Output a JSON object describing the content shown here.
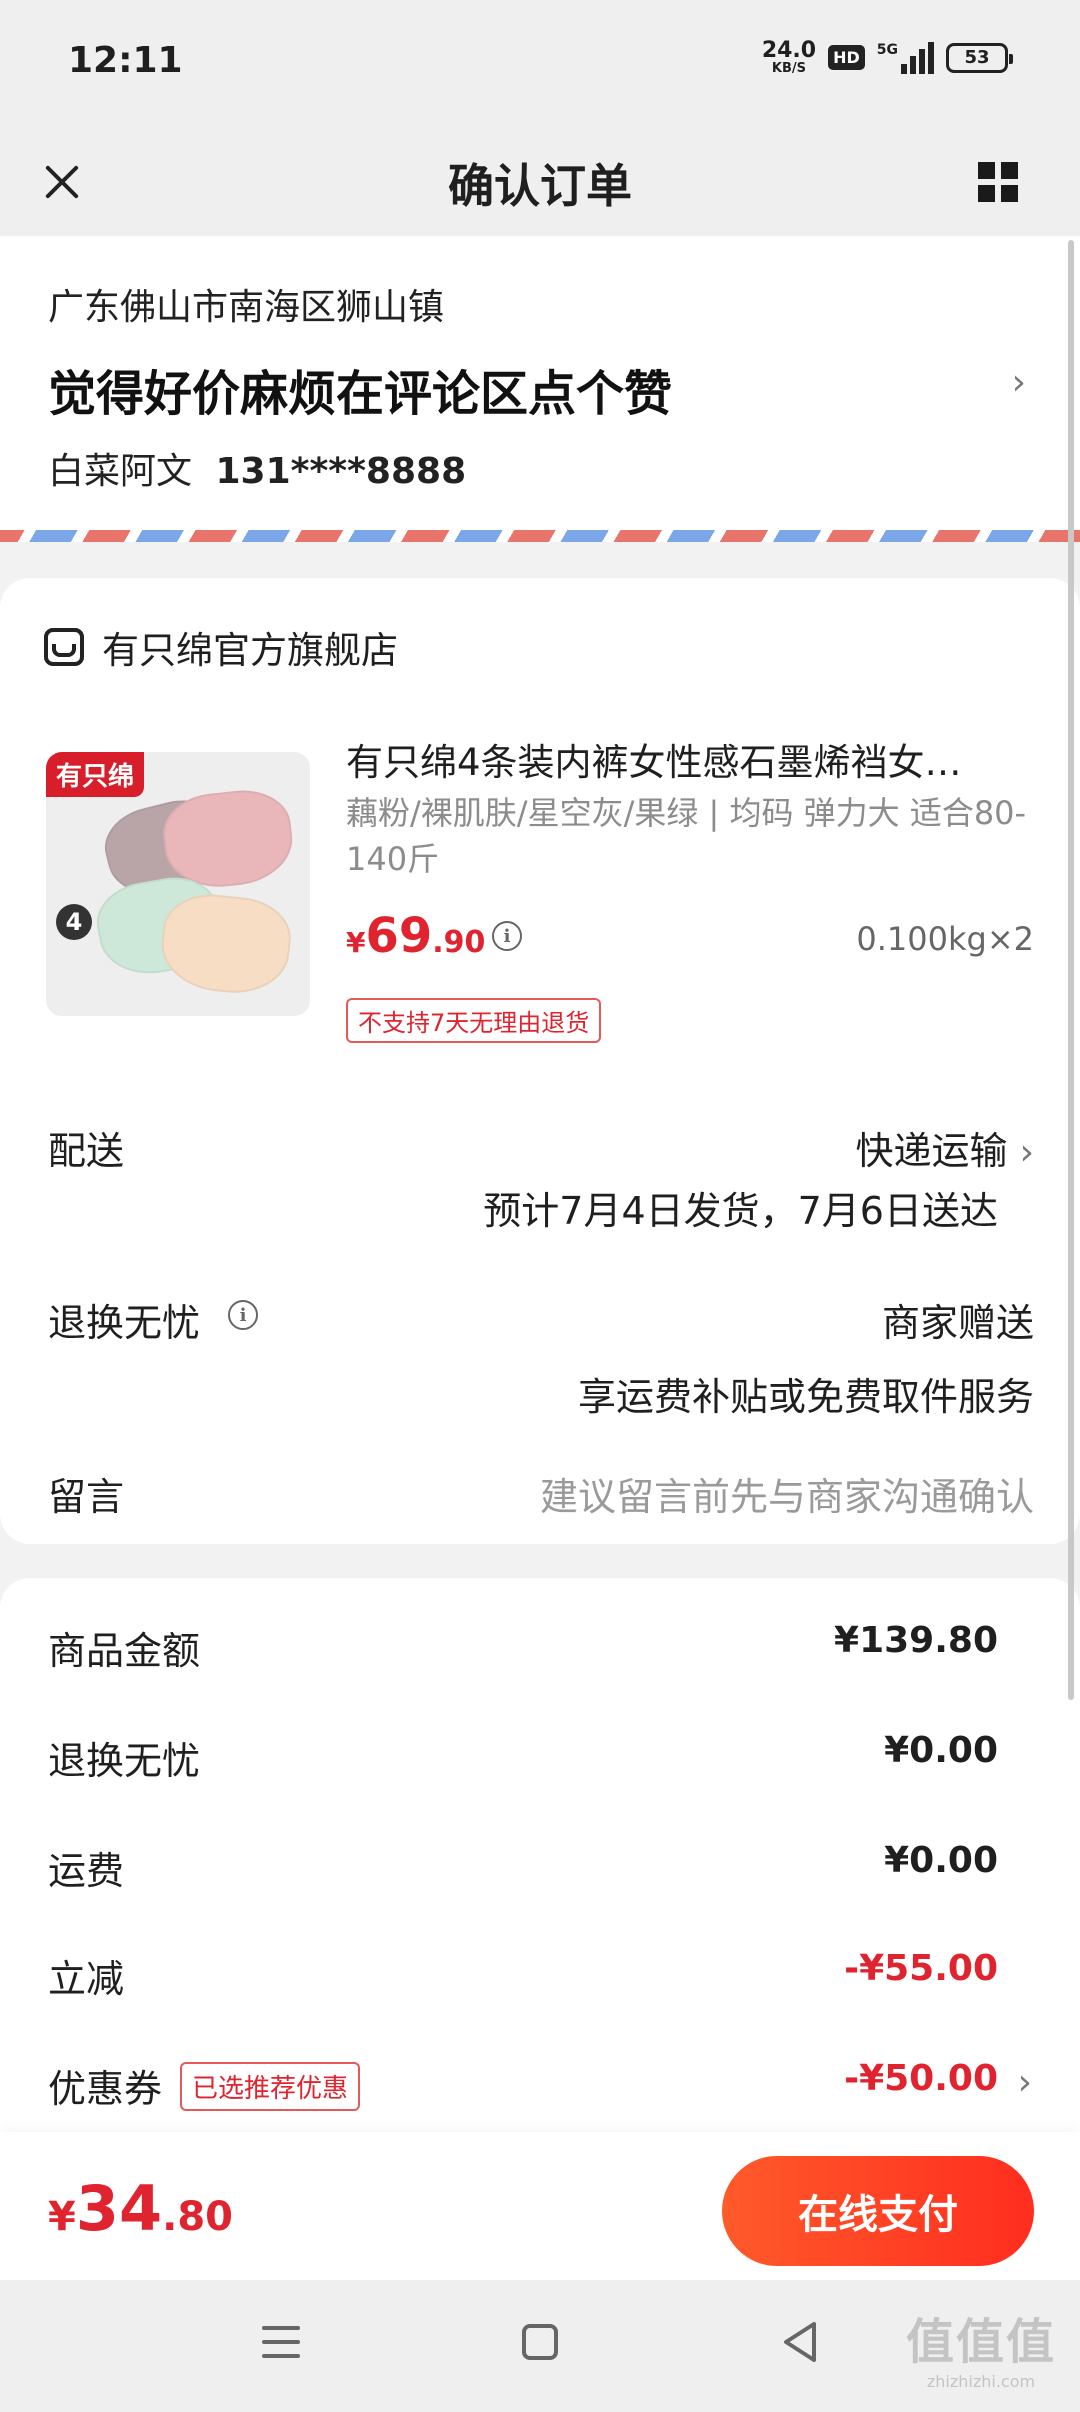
{
  "status_bar": {
    "time": "12:11",
    "net_speed": "24.0",
    "net_unit": "KB/S",
    "hd": "HD",
    "signal": "5G",
    "battery": "53"
  },
  "header": {
    "title": "确认订单"
  },
  "address": {
    "region": "广东佛山市南海区狮山镇",
    "detail": "觉得好价麻烦在评论区点个赞",
    "name": "白菜阿文",
    "phone": "131****8888"
  },
  "store": {
    "name": "有只绵官方旗舰店"
  },
  "product": {
    "thumb_brand": "有只绵",
    "thumb_count": "4",
    "title": "有只绵4条装内裤女性感石墨烯裆女…",
    "spec": "藕粉/裸肌肤/星空灰/果绿 | 均码 弹力大 适合80-140斤",
    "price_currency": "¥",
    "price_int": "69",
    "price_dec": ".90",
    "qty": "0.100kg×2",
    "tag": "不支持7天无理由退货"
  },
  "delivery": {
    "label": "配送",
    "method": "快递运输",
    "estimate": "预计7月4日发货，7月6日送达"
  },
  "exchange": {
    "label": "退换无忧",
    "value": "商家赠送",
    "desc": "享运费补贴或免费取件服务"
  },
  "message": {
    "label": "留言",
    "placeholder": "建议留言前先与商家沟通确认"
  },
  "amounts": {
    "goods_label": "商品金额",
    "goods_value": "¥139.80",
    "exchange_label": "退换无忧",
    "exchange_value": "¥0.00",
    "shipping_label": "运费",
    "shipping_value": "¥0.00",
    "discount_label": "立减",
    "discount_value": "-¥55.00",
    "coupon_label": "优惠券",
    "coupon_tag": "已选推荐优惠",
    "coupon_value": "-¥50.00"
  },
  "pay_bar": {
    "total_currency": "¥",
    "total_int": "34",
    "total_dec": ".80",
    "pay_label": "在线支付"
  },
  "watermark": {
    "logo": "值值值",
    "url": "zhizhizhi.com"
  },
  "colors": {
    "accent_red": "#e0242f",
    "pay_button": "#ff3a22"
  }
}
